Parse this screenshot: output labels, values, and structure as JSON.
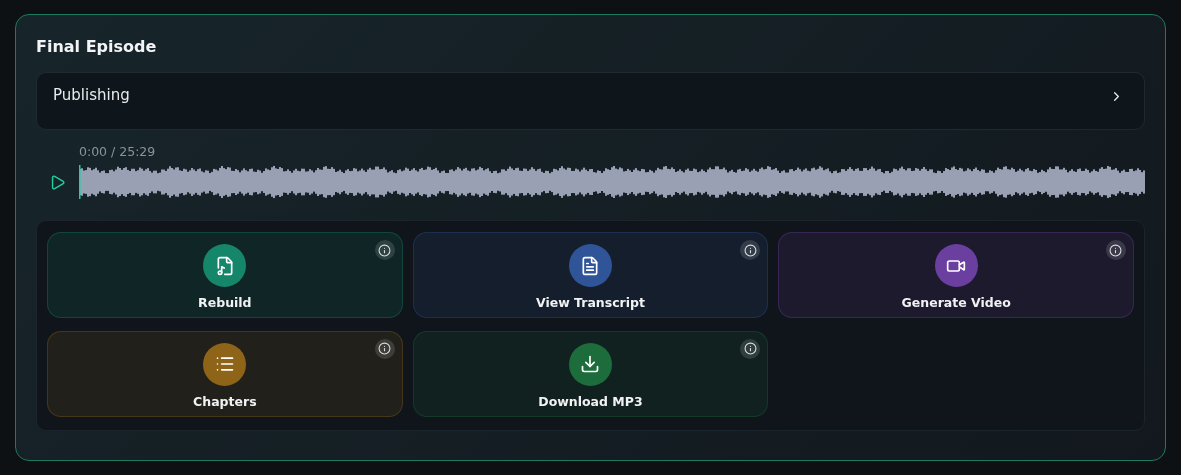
{
  "title": "Final Episode",
  "section": {
    "label": "Publishing",
    "expanded": false
  },
  "player": {
    "time": "0:00 / 25:29",
    "level": 0
  },
  "actions": [
    {
      "kind": "rebuild",
      "label": "Rebuild",
      "color": "#15866a"
    },
    {
      "kind": "transcript",
      "label": "View Transcript",
      "color": "#2f5497"
    },
    {
      "kind": "video",
      "label": "Generate Video",
      "color": "#6b3fa0"
    },
    {
      "kind": "chapters",
      "label": "Chapters",
      "color": "#8e6418"
    },
    {
      "kind": "download",
      "label": "Download MP3",
      "color": "#1d6d3c"
    }
  ]
}
